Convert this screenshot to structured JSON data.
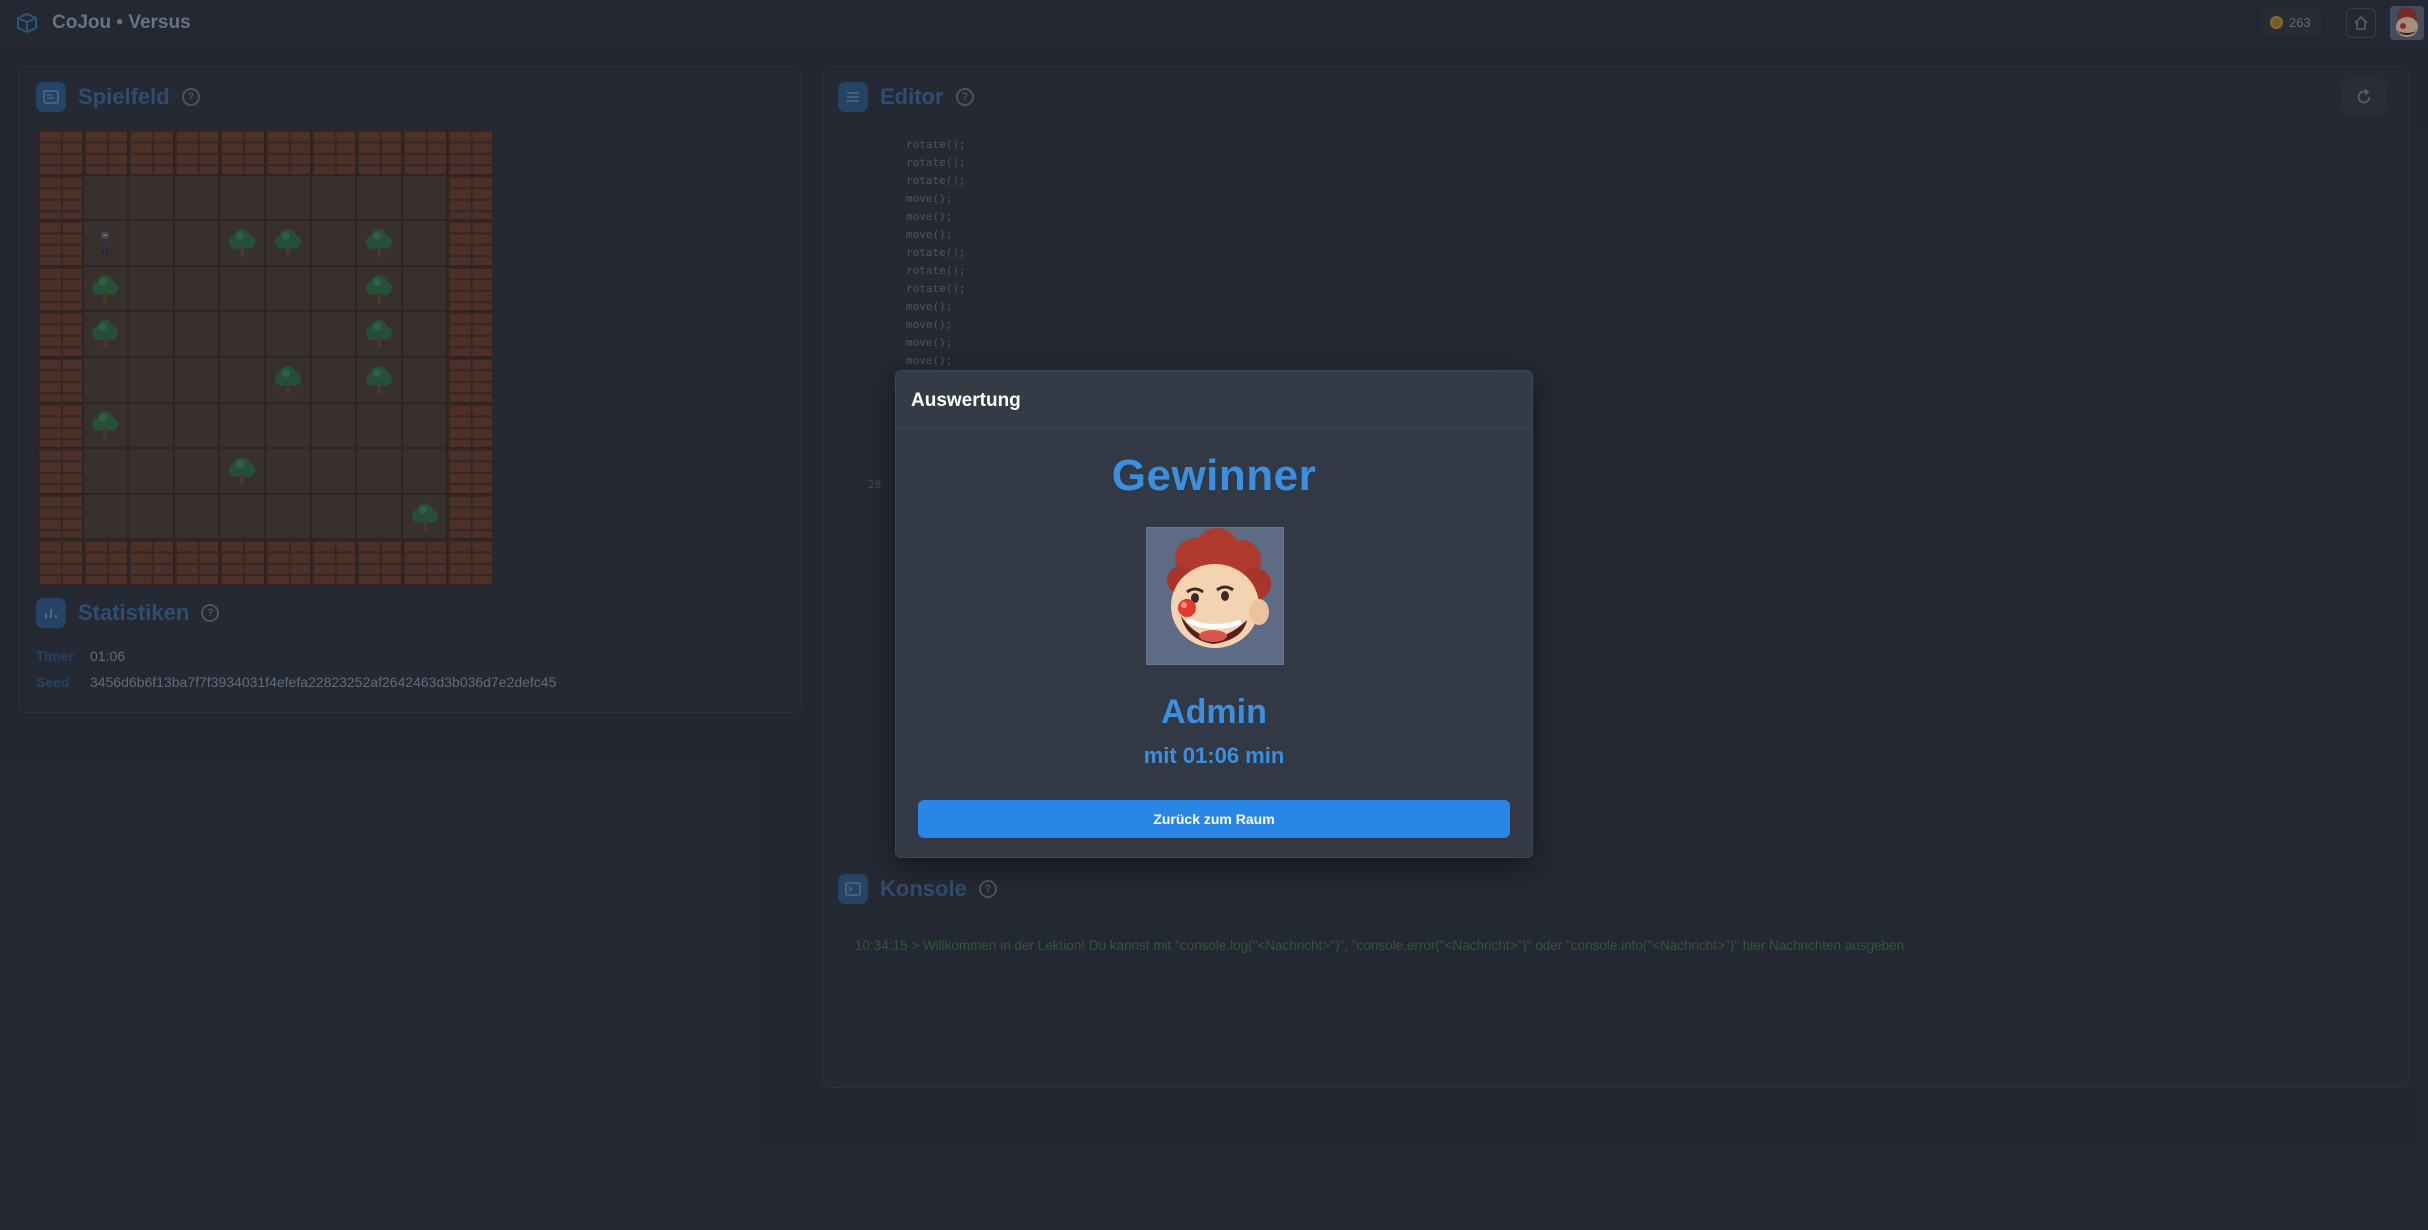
{
  "app": {
    "title": "CoJou • Versus",
    "coins": "263"
  },
  "playfield": {
    "title": "Spielfeld"
  },
  "stats": {
    "title": "Statistiken",
    "timer_label": "Timer",
    "timer_value": "01:06",
    "seed_label": "Seed",
    "seed_value": "3456d6b6f13ba7f7f3934031f4efefa22823252af2642463d3b036d7e2defc45"
  },
  "editor": {
    "title": "Editor",
    "code_lines": [
      "rotate();",
      "rotate();",
      "rotate();",
      "move();",
      "move();",
      "move();",
      "rotate();",
      "rotate();",
      "rotate();",
      "move();",
      "move();",
      "move();",
      "move();"
    ],
    "line_number": "28"
  },
  "console": {
    "title": "Konsole",
    "message": "10:34:15 > Willkommen in der Lektion! Du kannst mit \"console.log(\"<Nachricht>\")\", \"console.error(\"<Nachricht>\")\" oder \"console.info(\"<Nachricht>\")\" hier Nachrichten ausgeben."
  },
  "modal": {
    "title": "Auswertung",
    "heading": "Gewinner",
    "winner_name": "Admin",
    "winner_time": "mit 01:06 min",
    "back_button": "Zurück zum Raum"
  },
  "board": {
    "trees": [
      [
        2,
        4
      ],
      [
        2,
        5
      ],
      [
        2,
        7
      ],
      [
        3,
        1
      ],
      [
        3,
        7
      ],
      [
        4,
        1
      ],
      [
        4,
        7
      ],
      [
        5,
        5
      ],
      [
        5,
        7
      ],
      [
        6,
        1
      ],
      [
        7,
        4
      ],
      [
        8,
        8
      ]
    ],
    "robot": [
      2,
      1
    ]
  },
  "colors": {
    "accent": "#3b8fe0",
    "button": "#2a86e6",
    "console_text": "#3f7a40"
  }
}
